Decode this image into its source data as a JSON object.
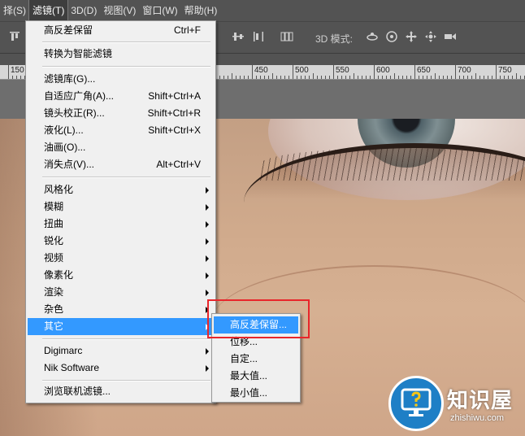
{
  "menubar": {
    "items": [
      {
        "label": "择(S)"
      },
      {
        "label": "滤镜(T)"
      },
      {
        "label": "3D(D)"
      },
      {
        "label": "视图(V)"
      },
      {
        "label": "窗口(W)"
      },
      {
        "label": "帮助(H)"
      }
    ]
  },
  "options_bar": {
    "mode_3d_label": "3D 模式:"
  },
  "ruler": {
    "labels": [
      "150",
      "500",
      "550",
      "600",
      "650",
      "700",
      "750",
      "450"
    ]
  },
  "filter_menu": {
    "items": [
      {
        "label": "高反差保留",
        "shortcut": "Ctrl+F"
      },
      {
        "label": "转换为智能滤镜"
      },
      {
        "label": "滤镜库(G)..."
      },
      {
        "label": "自适应广角(A)...",
        "shortcut": "Shift+Ctrl+A"
      },
      {
        "label": "镜头校正(R)...",
        "shortcut": "Shift+Ctrl+R"
      },
      {
        "label": "液化(L)...",
        "shortcut": "Shift+Ctrl+X"
      },
      {
        "label": "油画(O)..."
      },
      {
        "label": "消失点(V)...",
        "shortcut": "Alt+Ctrl+V"
      },
      {
        "label": "风格化"
      },
      {
        "label": "模糊"
      },
      {
        "label": "扭曲"
      },
      {
        "label": "锐化"
      },
      {
        "label": "视频"
      },
      {
        "label": "像素化"
      },
      {
        "label": "渲染"
      },
      {
        "label": "杂色"
      },
      {
        "label": "其它"
      },
      {
        "label": "Digimarc"
      },
      {
        "label": "Nik Software"
      },
      {
        "label": "浏览联机滤镜..."
      }
    ]
  },
  "submenu": {
    "items": [
      {
        "label": "高反差保留..."
      },
      {
        "label": "位移..."
      },
      {
        "label": "自定..."
      },
      {
        "label": "最大值..."
      },
      {
        "label": "最小值..."
      }
    ]
  },
  "watermark": {
    "title": "知识屋",
    "url": "zhishiwu.com"
  },
  "colors": {
    "highlight": "#3399ff",
    "annotation_red": "#e8262b",
    "watermark_blue": "#1e7fc6"
  }
}
